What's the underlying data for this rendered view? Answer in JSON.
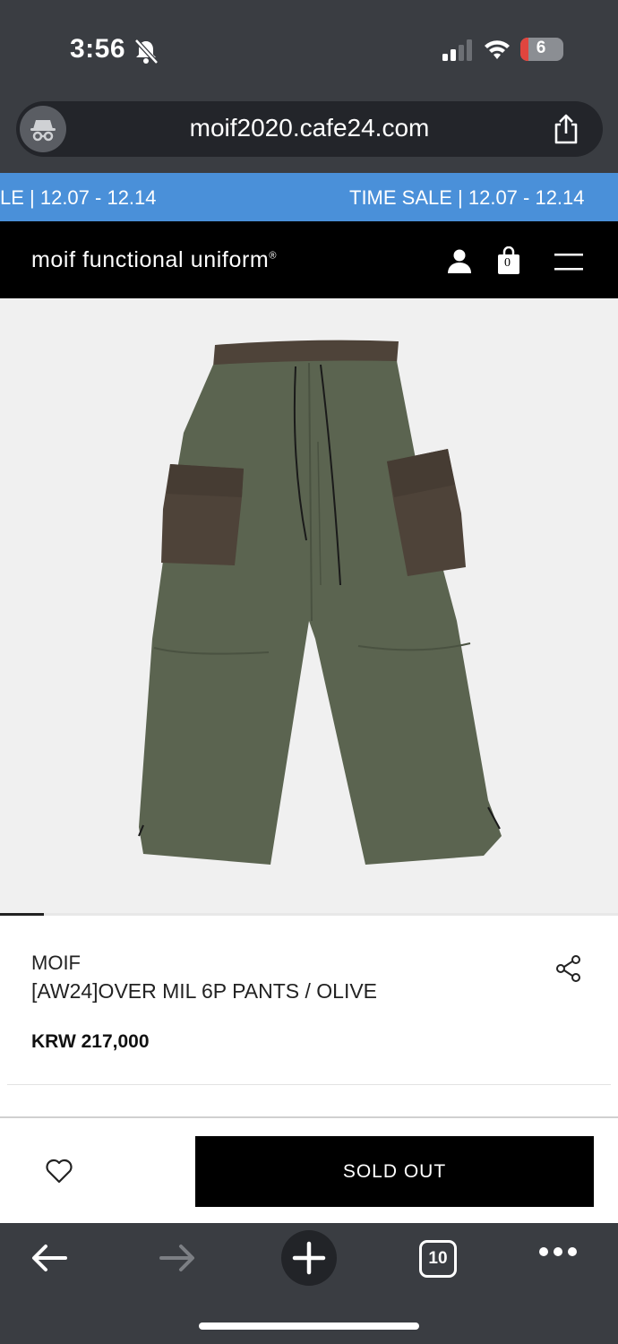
{
  "status_bar": {
    "time": "3:56",
    "battery": "6"
  },
  "browser": {
    "url": "moif2020.cafe24.com",
    "tab_count": "10"
  },
  "ticker": {
    "left_text": "LE | 12.07 - 12.14",
    "right_text": "TIME SALE | 12.07 - 12.14"
  },
  "site_header": {
    "brand": "moif functional uniform",
    "brand_mark": "®",
    "cart_count": "0"
  },
  "product": {
    "brand": "MOIF",
    "title": "[AW24]OVER MIL 6P PANTS / OLIVE",
    "price": "KRW 217,000",
    "action_label": "SOLD OUT"
  },
  "colors": {
    "ticker": "#4a90d9",
    "header": "#000000",
    "pants": "#5b6450",
    "pockets": "#4e4339"
  }
}
